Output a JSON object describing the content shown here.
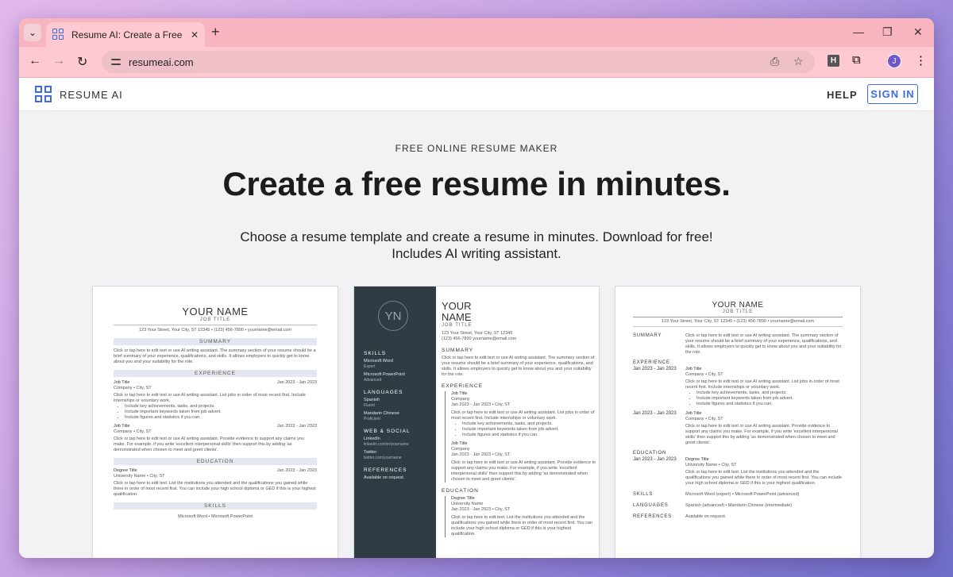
{
  "browser": {
    "tab_title": "Resume AI: Create a Free Resume",
    "url": "resumeai.com",
    "profile_initial": "J",
    "extension_badge": "H"
  },
  "header": {
    "brand": "RESUME AI",
    "help": "HELP",
    "sign_in": "SIGN IN"
  },
  "hero": {
    "eyebrow": "FREE ONLINE RESUME MAKER",
    "headline": "Create a free resume in minutes.",
    "subtext_line1": "Choose a resume template and create a resume in minutes. Download for free!",
    "subtext_line2": "Includes AI writing assistant."
  },
  "templates": {
    "common": {
      "your_name": "YOUR NAME",
      "your": "YOUR",
      "name": "NAME",
      "job_title": "JOB TITLE",
      "contact": "123 Your Street, Your City, ST 12345 • (123) 456-7890 • yourname@email.com",
      "contact_t2": "123 Your Street, Your City, ST 12345",
      "contact_t2b": "(123) 456-7890  yourname@email.com",
      "summary_h": "SUMMARY",
      "experience_h": "EXPERIENCE",
      "education_h": "EDUCATION",
      "skills_h": "SKILLS",
      "languages_h": "LANGUAGES",
      "references_h": "REFERENCES",
      "web_social_h": "WEB & SOCIAL",
      "summary_text": "Click or tap here to edit text or use AI writing assistant. The summary section of your resume should be a brief summary of your experience, qualifications, and skills. It allows employers to quickly get to know about you and your suitability for the role.",
      "job_title_item": "Job Title",
      "company": "Company • City, ST",
      "company_t2": "Company",
      "dates": "Jan 2023 - Jan 2023",
      "dates_t2": "Jan 2023 - Jan 2023 • City, ST",
      "exp1_text": "Click or tap here to edit text or use AI writing assistant. List jobs in order of most recent first. Include internships or voluntary work.",
      "bullet1": "Include key achievements, tasks, and projects.",
      "bullet2": "Include important keywords taken from job advert.",
      "bullet3": "Include figures and statistics if you can.",
      "exp2_text": "Click or tap here to edit text or use AI writing assistant. Provide evidence to support any claims you make. For example, if you write 'excellent interpersonal skills' then support this by adding 'as demonstrated when chosen to meet and greet clients'.",
      "degree": "Degree Title",
      "university": "University Name • City, ST",
      "university_t2": "University Name",
      "edu_text": "Click or tap here to edit text. List the institutions you attended and the qualifications you gained while there in order of most recent first. You can include your high school diploma or GED if this is your highest qualification.",
      "skills_line": "Microsoft Word • Microsoft PowerPoint",
      "skills_line_t3": "Microsoft Word (expert) • Microsoft PowerPoint (advanced)",
      "languages_line_t3": "Spanish (advanced) • Mandarin Chinese (intermediate)",
      "references_text": "Available on request."
    },
    "t2": {
      "monogram": "YN",
      "skill1": "Microsoft Word",
      "skill1_level": "Expert",
      "skill2": "Microsoft PowerPoint",
      "skill2_level": "Advanced",
      "lang1": "Spanish",
      "lang1_level": "Fluent",
      "lang2": "Mandarin Chinese",
      "lang2_level": "Proficient",
      "web1": "LinkedIn",
      "web1_val": "linkedin.com/in/yourname",
      "web2": "Twitter",
      "web2_val": "twitter.com/yourname",
      "references_text": "Available on request."
    }
  }
}
